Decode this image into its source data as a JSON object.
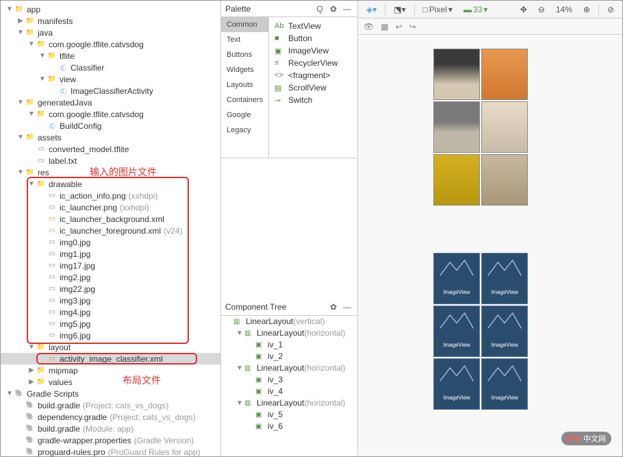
{
  "annotations": {
    "input_images": "输入的图片文件",
    "layout_file": "布局文件",
    "layout_label": "布局"
  },
  "project_tree": {
    "root": "app",
    "nodes": [
      {
        "depth": 0,
        "arrow": "▼",
        "icon": "folder",
        "label": "app",
        "key": "app"
      },
      {
        "depth": 1,
        "arrow": "▶",
        "icon": "folder",
        "label": "manifests",
        "key": "manifests"
      },
      {
        "depth": 1,
        "arrow": "▼",
        "icon": "folder",
        "label": "java",
        "key": "java"
      },
      {
        "depth": 2,
        "arrow": "▼",
        "icon": "folder",
        "label": "com.google.tflite.catvsdog",
        "key": "pkg1"
      },
      {
        "depth": 3,
        "arrow": "▼",
        "icon": "folder",
        "label": "tflite",
        "key": "tflite"
      },
      {
        "depth": 4,
        "arrow": "",
        "icon": "class",
        "label": "Classifier",
        "key": "classifier"
      },
      {
        "depth": 3,
        "arrow": "▼",
        "icon": "folder",
        "label": "view",
        "key": "viewpkg"
      },
      {
        "depth": 4,
        "arrow": "",
        "icon": "class",
        "label": "ImageClassifierActivity",
        "key": "ica"
      },
      {
        "depth": 1,
        "arrow": "▼",
        "icon": "folder",
        "label": "generatedJava",
        "key": "genjava"
      },
      {
        "depth": 2,
        "arrow": "▼",
        "icon": "folder",
        "label": "com.google.tflite.catvsdog",
        "key": "pkg2"
      },
      {
        "depth": 3,
        "arrow": "",
        "icon": "class",
        "label": "BuildConfig",
        "key": "buildconfig"
      },
      {
        "depth": 1,
        "arrow": "▼",
        "icon": "folder",
        "label": "assets",
        "key": "assets"
      },
      {
        "depth": 2,
        "arrow": "",
        "icon": "file",
        "label": "converted_model.tflite",
        "key": "model"
      },
      {
        "depth": 2,
        "arrow": "",
        "icon": "file",
        "label": "label.txt",
        "key": "labeltxt"
      },
      {
        "depth": 1,
        "arrow": "▼",
        "icon": "folder",
        "label": "res",
        "key": "res"
      },
      {
        "depth": 2,
        "arrow": "▼",
        "icon": "folder",
        "label": "drawable",
        "key": "drawable"
      },
      {
        "depth": 3,
        "arrow": "",
        "icon": "file",
        "label": "ic_action_info.png",
        "suffix": "(xxhdpi)",
        "key": "icinfo"
      },
      {
        "depth": 3,
        "arrow": "",
        "icon": "file",
        "label": "ic_launcher.png",
        "suffix": "(xxhdpi)",
        "key": "iclauncher"
      },
      {
        "depth": 3,
        "arrow": "",
        "icon": "xml",
        "label": "ic_launcher_background.xml",
        "key": "icbg"
      },
      {
        "depth": 3,
        "arrow": "",
        "icon": "xml",
        "label": "ic_launcher_foreground.xml",
        "suffix": "(v24)",
        "key": "icfg"
      },
      {
        "depth": 3,
        "arrow": "",
        "icon": "file",
        "label": "img0.jpg",
        "key": "img0"
      },
      {
        "depth": 3,
        "arrow": "",
        "icon": "file",
        "label": "img1.jpg",
        "key": "img1"
      },
      {
        "depth": 3,
        "arrow": "",
        "icon": "file",
        "label": "img17.jpg",
        "key": "img17"
      },
      {
        "depth": 3,
        "arrow": "",
        "icon": "file",
        "label": "img2.jpg",
        "key": "img2"
      },
      {
        "depth": 3,
        "arrow": "",
        "icon": "file",
        "label": "img22.jpg",
        "key": "img22"
      },
      {
        "depth": 3,
        "arrow": "",
        "icon": "file",
        "label": "img3.jpg",
        "key": "img3"
      },
      {
        "depth": 3,
        "arrow": "",
        "icon": "file",
        "label": "img4.jpg",
        "key": "img4"
      },
      {
        "depth": 3,
        "arrow": "",
        "icon": "file",
        "label": "img5.jpg",
        "key": "img5"
      },
      {
        "depth": 3,
        "arrow": "",
        "icon": "file",
        "label": "img6.jpg",
        "key": "img6"
      },
      {
        "depth": 2,
        "arrow": "▼",
        "icon": "folder",
        "label": "layout",
        "key": "layout"
      },
      {
        "depth": 3,
        "arrow": "",
        "icon": "xml",
        "label": "activity_image_classifier.xml",
        "key": "activityxml",
        "selected": true
      },
      {
        "depth": 2,
        "arrow": "▶",
        "icon": "folder",
        "label": "mipmap",
        "key": "mipmap"
      },
      {
        "depth": 2,
        "arrow": "▶",
        "icon": "folder",
        "label": "values",
        "key": "values"
      },
      {
        "depth": 0,
        "arrow": "▼",
        "icon": "gradle",
        "label": "Gradle Scripts",
        "key": "gradle"
      },
      {
        "depth": 1,
        "arrow": "",
        "icon": "gradle-file",
        "label": "build.gradle",
        "suffix": "(Project: cats_vs_dogs)",
        "key": "bg1"
      },
      {
        "depth": 1,
        "arrow": "",
        "icon": "gradle-file",
        "label": "dependency.gradle",
        "suffix": "(Project: cats_vs_dogs)",
        "key": "dep"
      },
      {
        "depth": 1,
        "arrow": "",
        "icon": "gradle-file",
        "label": "build.gradle",
        "suffix": "(Module: app)",
        "key": "bg2"
      },
      {
        "depth": 1,
        "arrow": "",
        "icon": "gradle-file",
        "label": "gradle-wrapper.properties",
        "suffix": "(Gradle Version)",
        "key": "gwrap"
      },
      {
        "depth": 1,
        "arrow": "",
        "icon": "gradle-file",
        "label": "proguard-rules.pro",
        "suffix": "(ProGuard Rules for app)",
        "key": "proguard"
      }
    ]
  },
  "palette": {
    "title": "Palette",
    "categories": [
      "Common",
      "Text",
      "Buttons",
      "Widgets",
      "Layouts",
      "Containers",
      "Google",
      "Legacy"
    ],
    "active_category": "Common",
    "items": [
      {
        "icon": "Ab",
        "label": "TextView"
      },
      {
        "icon": "■",
        "label": "Button"
      },
      {
        "icon": "▣",
        "label": "ImageView"
      },
      {
        "icon": "≡",
        "label": "RecyclerView"
      },
      {
        "icon": "<>",
        "label": "<fragment>"
      },
      {
        "icon": "▤",
        "label": "ScrollView"
      },
      {
        "icon": "⊸",
        "label": "Switch"
      }
    ]
  },
  "component_tree": {
    "title": "Component Tree",
    "nodes": [
      {
        "depth": 0,
        "arrow": "",
        "icon": "layout",
        "label": "LinearLayout",
        "suffix": "(vertical)"
      },
      {
        "depth": 1,
        "arrow": "▼",
        "icon": "layout",
        "label": "LinearLayout",
        "suffix": "(horizontal)"
      },
      {
        "depth": 2,
        "arrow": "",
        "icon": "img",
        "label": "iv_1"
      },
      {
        "depth": 2,
        "arrow": "",
        "icon": "img",
        "label": "iv_2"
      },
      {
        "depth": 1,
        "arrow": "▼",
        "icon": "layout",
        "label": "LinearLayout",
        "suffix": "(horizontal)"
      },
      {
        "depth": 2,
        "arrow": "",
        "icon": "img",
        "label": "iv_3"
      },
      {
        "depth": 2,
        "arrow": "",
        "icon": "img",
        "label": "iv_4"
      },
      {
        "depth": 1,
        "arrow": "▼",
        "icon": "layout",
        "label": "LinearLayout",
        "suffix": "(horizontal)"
      },
      {
        "depth": 2,
        "arrow": "",
        "icon": "img",
        "label": "iv_5"
      },
      {
        "depth": 2,
        "arrow": "",
        "icon": "img",
        "label": "iv_6"
      }
    ]
  },
  "right_toolbar": {
    "device": "Pixel",
    "api": "33",
    "zoom": "14%"
  },
  "design_preview": {
    "image_cells": [
      "dog1",
      "cat1",
      "dog2",
      "cat2",
      "dog3",
      "dog4"
    ],
    "iv_label": "ImageView"
  },
  "watermark": {
    "brand": "php",
    "text": "中文网"
  }
}
